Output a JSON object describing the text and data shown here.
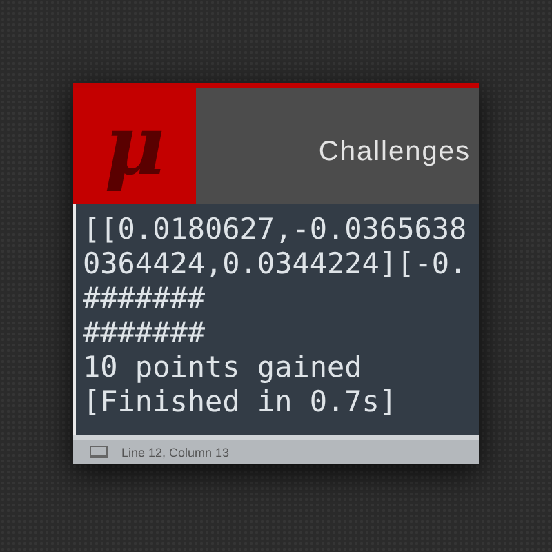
{
  "header": {
    "logo": "μ",
    "title": "Challenges"
  },
  "console": {
    "lines": [
      "[[0.0180627,-0.0365638",
      "0364424,0.0344224][-0.",
      "#######",
      "#######",
      "10 points gained",
      "[Finished in 0.7s]"
    ]
  },
  "status_bar": {
    "text": "Line 12, Column 13"
  }
}
